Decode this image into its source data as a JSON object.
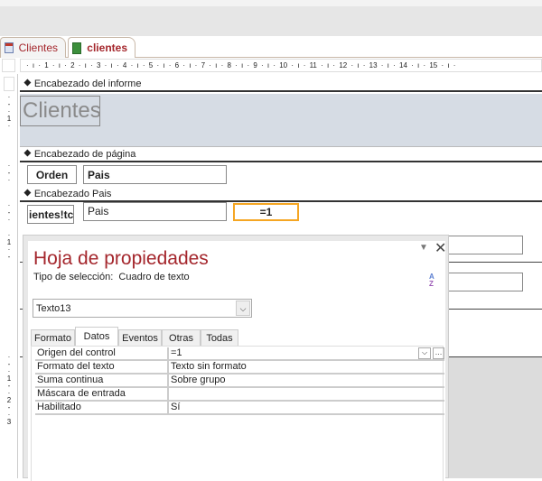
{
  "tabs": [
    {
      "label": "Clientes",
      "icon": "table-icon"
    },
    {
      "label": "clientes",
      "icon": "report-icon"
    }
  ],
  "ruler": "· ı · 1 · ı · 2 · ı · 3 · ı · 4 · ı · 5 · ı · 6 · ı · 7 · ı · 8 · ı · 9 · ı · 10 · ı · 11 · ı · 12 · ı · 13 · ı · 14 · ı · 15 · ı ·",
  "sections": {
    "report_header": "Encabezado del informe",
    "page_header": "Encabezado de página",
    "group_header": "Encabezado Pais"
  },
  "controls": {
    "title": "Clientes",
    "orden": "Orden",
    "pais_label": "Pais",
    "clientes_field": "ientes!tc",
    "pais_field": "Pais",
    "texto13": "=1"
  },
  "vruler": [
    "1",
    "1",
    "2",
    "3"
  ],
  "panel": {
    "title": "Hoja de propiedades",
    "selection_type_label": "Tipo de selección:",
    "selection_type": "Cuadro de texto",
    "object": "Texto13",
    "tabs": [
      "Formato",
      "Datos",
      "Eventos",
      "Otras",
      "Todas"
    ],
    "active_tab": "Datos",
    "rows": [
      {
        "key": "Origen del control",
        "value": "=1"
      },
      {
        "key": "Formato del texto",
        "value": "Texto sin formato"
      },
      {
        "key": "Suma continua",
        "value": "Sobre grupo"
      },
      {
        "key": "Máscara de entrada",
        "value": ""
      },
      {
        "key": "Habilitado",
        "value": "Sí"
      }
    ]
  },
  "colors": {
    "accent": "#a4262c",
    "selection": "#f5a623",
    "section_bg": "#d6dce4"
  }
}
